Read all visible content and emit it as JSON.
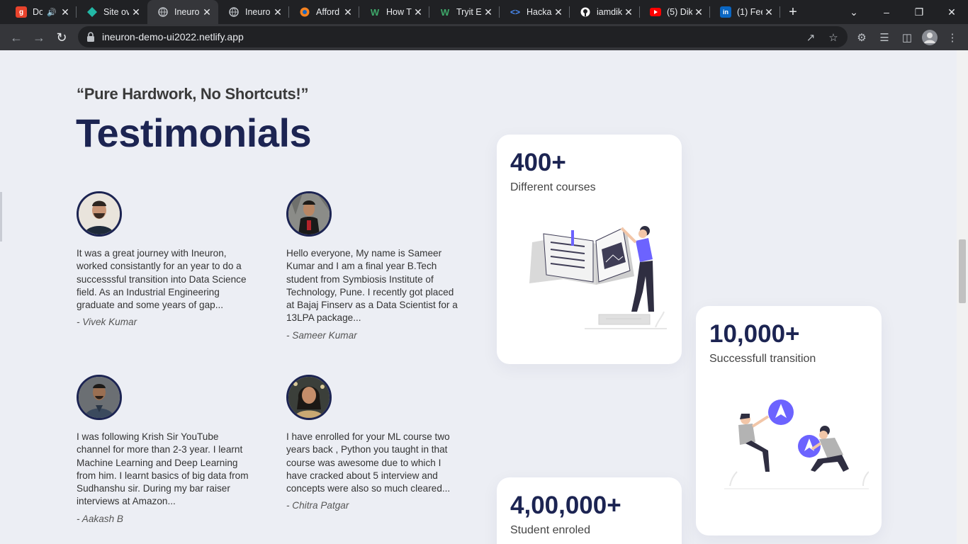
{
  "browser": {
    "tabs": [
      {
        "title": "Do",
        "favicon": "g-icon",
        "color": "#e8432c",
        "muted": true
      },
      {
        "title": "Site ov",
        "favicon": "netlify-icon",
        "color": "#22b8a6"
      },
      {
        "title": "Ineuro",
        "favicon": "globe-icon",
        "color": "#9aa0a6",
        "active": true
      },
      {
        "title": "Ineuro",
        "favicon": "globe-icon",
        "color": "#9aa0a6"
      },
      {
        "title": "Afford",
        "favicon": "orange-circle-icon",
        "color": "#f58220"
      },
      {
        "title": "How T",
        "favicon": "w-icon",
        "color": "#3ea86a"
      },
      {
        "title": "Tryit E",
        "favicon": "w-icon",
        "color": "#3ea86a"
      },
      {
        "title": "Hacka",
        "favicon": "code-icon",
        "color": "#4a8cf7"
      },
      {
        "title": "iamdik",
        "favicon": "github-icon",
        "color": "#ffffff"
      },
      {
        "title": "(5) Dik",
        "favicon": "youtube-icon",
        "color": "#ff0000"
      },
      {
        "title": "(1) Fee",
        "favicon": "linkedin-icon",
        "color": "#0a66c2"
      }
    ],
    "url": "ineuron-demo-ui2022.netlify.app"
  },
  "page": {
    "quote": "“Pure Hardwork, No Shortcuts!”",
    "heading": "Testimonials",
    "testimonials": [
      {
        "text": "It was a great journey with Ineuron, worked consistantly for an year to do a successsful transition into Data Science field. As an Industrial Engineering graduate and some years of gap...",
        "author": "- Vivek Kumar"
      },
      {
        "text": "Hello everyone, My name is Sameer Kumar and I am a final year B.Tech student from Symbiosis Institute of Technology, Pune. I recently got placed at Bajaj Finserv as a Data Scientist for a 13LPA package...",
        "author": "- Sameer Kumar"
      },
      {
        "text": "I was following Krish Sir YouTube channel for more than 2-3 year. I learnt Machine Learning and Deep Learning from him. I learnt basics of big data from Sudhanshu sir. During my bar raiser interviews at Amazon...",
        "author": "- Aakash B"
      },
      {
        "text": "I have enrolled for your ML course two years back , Python you taught in that course was awesome due to which I have cracked about 5 interview and concepts were also so much cleared...",
        "author": "- Chitra Patgar"
      }
    ],
    "stats": [
      {
        "value": "400+",
        "label": "Different courses"
      },
      {
        "value": "10,000+",
        "label": "Successfull transition"
      },
      {
        "value": "4,00,000+",
        "label": "Student enroled"
      }
    ],
    "accent_color": "#1c2452",
    "illustration_color": "#6c63ff"
  }
}
